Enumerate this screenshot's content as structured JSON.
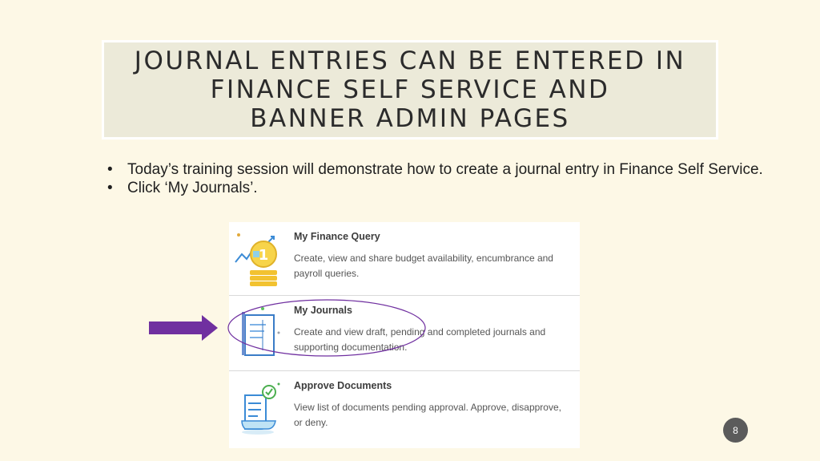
{
  "title": {
    "lines": [
      "JOURNAL ENTRIES CAN BE ENTERED IN",
      "FINANCE SELF SERVICE AND",
      "BANNER ADMIN PAGES"
    ]
  },
  "bullets": [
    {
      "marker": "•",
      "text": "Today’s training session will demonstrate how to create a journal entry in Finance Self Service."
    },
    {
      "marker": "•",
      "text": "Click ‘My Journals’."
    }
  ],
  "cards": [
    {
      "title": "My Finance Query",
      "description": "Create, view and share budget availability, encumbrance and payroll queries.",
      "icon": "finance-coins-icon"
    },
    {
      "title": "My Journals",
      "description": "Create and view draft, pending and completed journals and supporting documentation.",
      "icon": "journal-document-icon"
    },
    {
      "title": "Approve Documents",
      "description": "View list of documents pending approval. Approve, disapprove, or deny.",
      "icon": "approve-document-icon"
    }
  ],
  "icon_finance_label": "1",
  "colors": {
    "arrow": "#7030a0",
    "ellipse": "#7030a0",
    "background": "#fdf8e6",
    "title_box": "#ecead9"
  },
  "page_number": "8"
}
